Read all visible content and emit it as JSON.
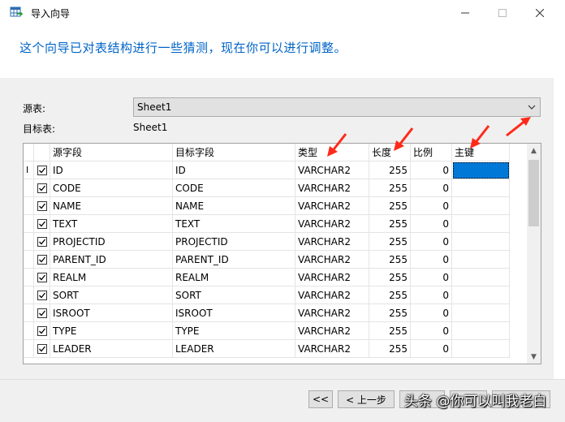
{
  "window": {
    "title": "导入向导",
    "minimize_icon": "minimize-icon",
    "maximize_icon": "maximize-icon",
    "close_icon": "close-icon"
  },
  "subtitle": "这个向导已对表结构进行一些猜测，现在你可以进行调整。",
  "source": {
    "label": "源表:",
    "value": "Sheet1"
  },
  "target": {
    "label": "目标表:",
    "value": "Sheet1"
  },
  "grid": {
    "headers": {
      "source": "源字段",
      "target": "目标字段",
      "type": "类型",
      "length": "长度",
      "scale": "比例",
      "pk": "主键"
    },
    "rows": [
      {
        "checked": true,
        "source": "ID",
        "target": "ID",
        "type": "VARCHAR2",
        "length": "255",
        "scale": "0",
        "pk": ""
      },
      {
        "checked": true,
        "source": "CODE",
        "target": "CODE",
        "type": "VARCHAR2",
        "length": "255",
        "scale": "0",
        "pk": ""
      },
      {
        "checked": true,
        "source": "NAME",
        "target": "NAME",
        "type": "VARCHAR2",
        "length": "255",
        "scale": "0",
        "pk": ""
      },
      {
        "checked": true,
        "source": "TEXT",
        "target": "TEXT",
        "type": "VARCHAR2",
        "length": "255",
        "scale": "0",
        "pk": ""
      },
      {
        "checked": true,
        "source": "PROJECTID",
        "target": "PROJECTID",
        "type": "VARCHAR2",
        "length": "255",
        "scale": "0",
        "pk": ""
      },
      {
        "checked": true,
        "source": "PARENT_ID",
        "target": "PARENT_ID",
        "type": "VARCHAR2",
        "length": "255",
        "scale": "0",
        "pk": ""
      },
      {
        "checked": true,
        "source": "REALM",
        "target": "REALM",
        "type": "VARCHAR2",
        "length": "255",
        "scale": "0",
        "pk": ""
      },
      {
        "checked": true,
        "source": "SORT",
        "target": "SORT",
        "type": "VARCHAR2",
        "length": "255",
        "scale": "0",
        "pk": ""
      },
      {
        "checked": true,
        "source": "ISROOT",
        "target": "ISROOT",
        "type": "VARCHAR2",
        "length": "255",
        "scale": "0",
        "pk": ""
      },
      {
        "checked": true,
        "source": "TYPE",
        "target": "TYPE",
        "type": "VARCHAR2",
        "length": "255",
        "scale": "0",
        "pk": ""
      },
      {
        "checked": true,
        "source": "LEADER",
        "target": "LEADER",
        "type": "VARCHAR2",
        "length": "255",
        "scale": "0",
        "pk": ""
      }
    ]
  },
  "footer": {
    "first_button": "<<",
    "prev_button": "< 上一步"
  },
  "watermark": "头条 @你可以叫我老白",
  "colors": {
    "accent": "#0064c8",
    "selection": "#0078d7",
    "annotation_arrow": "#ff2a1a"
  }
}
